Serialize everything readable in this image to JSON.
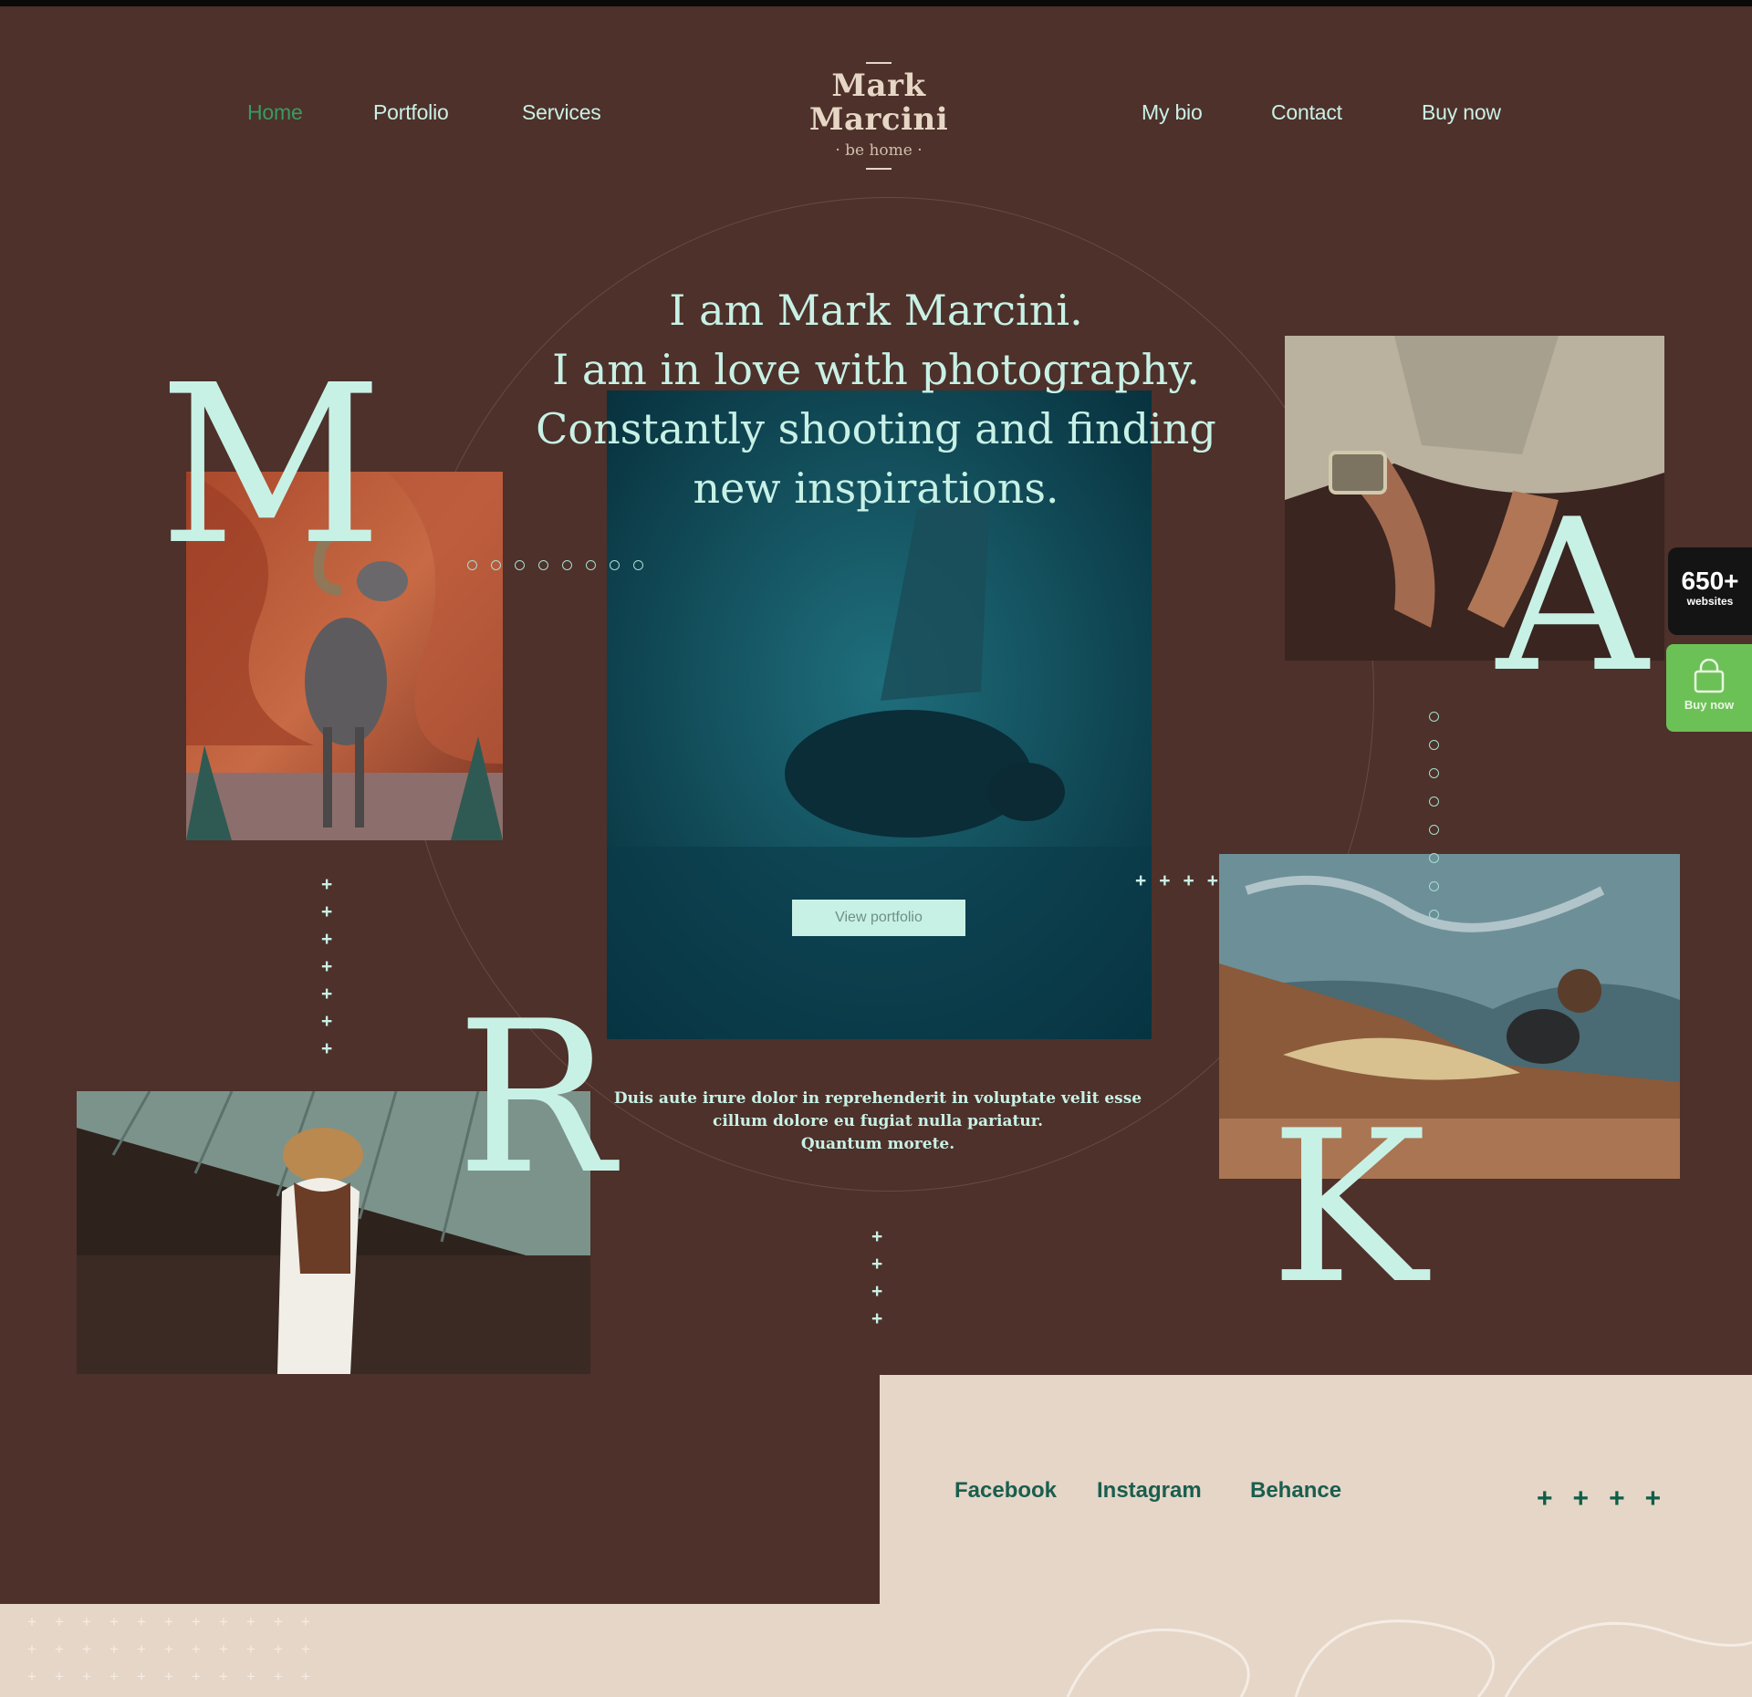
{
  "nav": {
    "home": "Home",
    "portfolio": "Portfolio",
    "services": "Services",
    "my_bio": "My bio",
    "contact": "Contact",
    "buy_now": "Buy now"
  },
  "logo": {
    "line1": "Mark",
    "line2": "Marcini",
    "tagline": "· be home ·"
  },
  "hero": {
    "headline": [
      "I am Mark Marcini.",
      "I am in love with photography.",
      "Constantly shooting and finding",
      "new inspirations."
    ],
    "button": "View portfolio",
    "paragraph": [
      "Duis aute irure dolor in reprehenderit in voluptate velit esse",
      "cillum dolore eu fugiat nulla pariatur.",
      "Quantum morete."
    ]
  },
  "letters": {
    "m": "M",
    "a": "A",
    "r": "R",
    "k": "K"
  },
  "widgets": {
    "websites_count": "650+",
    "websites_label": "websites",
    "buy_label": "Buy now"
  },
  "social": {
    "facebook": "Facebook",
    "instagram": "Instagram",
    "behance": "Behance"
  },
  "colors": {
    "background": "#4d312a",
    "accent_mint": "#c8f1e6",
    "active_nav": "#3a9a62",
    "panel": "#e5d6c8",
    "social_text": "#1a5e4e",
    "buy_widget": "#6cc156"
  }
}
